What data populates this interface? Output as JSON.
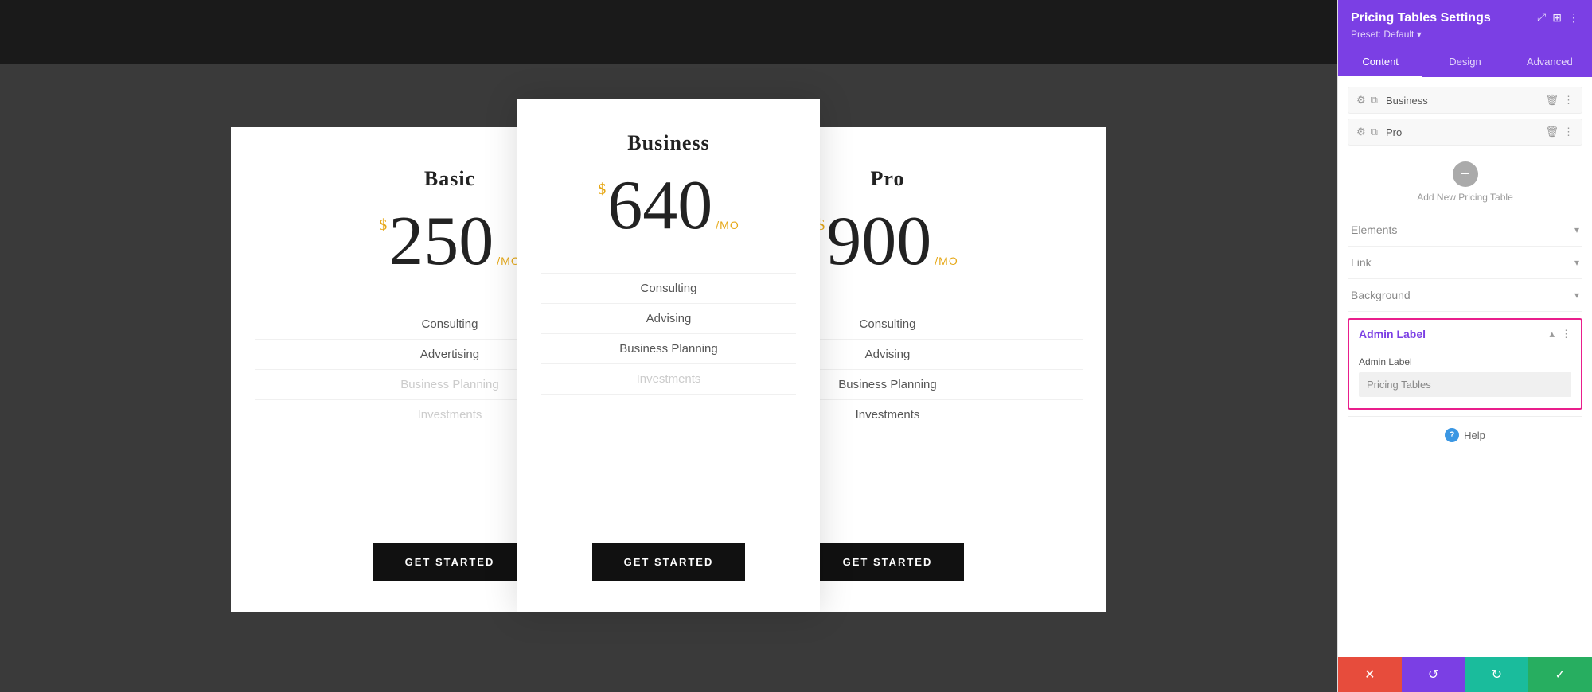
{
  "sidebar": {
    "title": "Pricing Tables Settings",
    "preset": "Preset: Default ▾",
    "tabs": [
      {
        "id": "content",
        "label": "Content",
        "active": true
      },
      {
        "id": "design",
        "label": "Design",
        "active": false
      },
      {
        "id": "advanced",
        "label": "Advanced",
        "active": false
      }
    ],
    "table_items": [
      {
        "label": "Business"
      },
      {
        "label": "Pro"
      }
    ],
    "add_new_label": "Add New Pricing Table",
    "sections": [
      {
        "id": "elements",
        "label": "Elements"
      },
      {
        "id": "link",
        "label": "Link"
      },
      {
        "id": "background",
        "label": "Background"
      }
    ],
    "admin_label": {
      "title": "Admin Label",
      "field_label": "Admin Label",
      "field_value": "Pricing Tables"
    },
    "help_label": "Help",
    "toolbar": {
      "cancel_label": "✕",
      "undo_label": "↺",
      "redo_label": "↻",
      "save_label": "✓"
    }
  },
  "pricing": {
    "cards": [
      {
        "id": "basic",
        "name": "Basic",
        "currency": "$",
        "price": "250",
        "period": "/MO",
        "features": [
          {
            "label": "Consulting",
            "disabled": false
          },
          {
            "label": "Advertising",
            "disabled": false
          },
          {
            "label": "Business Planning",
            "disabled": true
          },
          {
            "label": "Investments",
            "disabled": true
          }
        ],
        "cta": "GET STARTED"
      },
      {
        "id": "business",
        "name": "Business",
        "currency": "$",
        "price": "640",
        "period": "/MO",
        "features": [
          {
            "label": "Consulting",
            "disabled": false
          },
          {
            "label": "Advising",
            "disabled": false
          },
          {
            "label": "Business Planning",
            "disabled": false
          },
          {
            "label": "Investments",
            "disabled": true
          }
        ],
        "cta": "GET STARTED",
        "featured": true
      },
      {
        "id": "pro",
        "name": "Pro",
        "currency": "$",
        "price": "900",
        "period": "/MO",
        "features": [
          {
            "label": "Consulting",
            "disabled": false
          },
          {
            "label": "Advising",
            "disabled": false
          },
          {
            "label": "Business Planning",
            "disabled": false
          },
          {
            "label": "Investments",
            "disabled": false
          }
        ],
        "cta": "GET STARTED"
      }
    ]
  },
  "colors": {
    "accent": "#e6a817",
    "purple": "#7b3fe4",
    "pink": "#e91e8c",
    "red": "#e74c3c",
    "teal": "#1abc9c",
    "green": "#27ae60"
  }
}
